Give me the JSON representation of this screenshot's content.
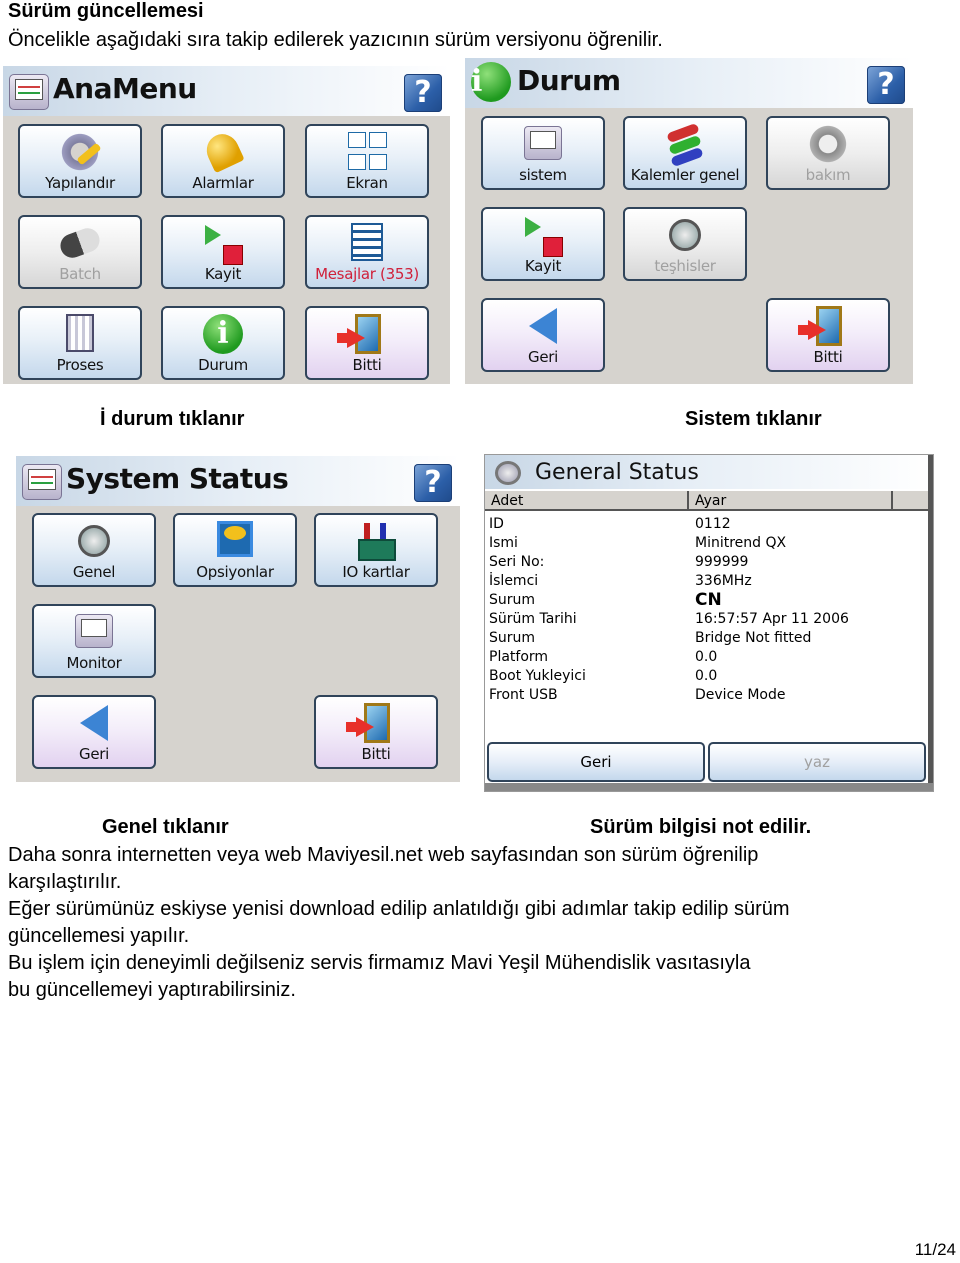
{
  "document": {
    "heading": "Sürüm güncellemesi",
    "intro": "Öncelikle aşağıdaki sıra takip edilerek yazıcının sürüm versiyonu öğrenilir.",
    "caption_1": "İ durum tıklanır",
    "caption_2": "Sistem tıklanır",
    "caption_3": "Genel tıklanır",
    "caption_4": "Sürüm bilgisi not edilir.",
    "paragraphs": [
      "Daha sonra internetten veya web Maviyesil.net web sayfasından son sürüm öğrenilip",
      "karşılaştırılır.",
      "Eğer sürümünüz eskiyse yenisi download edilip anlatıldığı gibi adımlar takip edilip sürüm",
      "güncellemesi yapılır.",
      "Bu işlem için deneyimli değilseniz servis firmamız Mavi Yeşil Mühendislik vasıtasıyla",
      "bu güncellemeyi yaptırabilirsiniz."
    ],
    "page_number": "11/24"
  },
  "ana_menu": {
    "title": "AnaMenu",
    "help": "?",
    "buttons": [
      {
        "label": "Yapılandır",
        "icon": "config-gear-icon",
        "state": "normal"
      },
      {
        "label": "Alarmlar",
        "icon": "bell-icon",
        "state": "normal"
      },
      {
        "label": "Ekran",
        "icon": "chart-grid-icon",
        "state": "normal"
      },
      {
        "label": "Batch",
        "icon": "pill-icon",
        "state": "disabled"
      },
      {
        "label": "Kayit",
        "icon": "play-stop-icon",
        "state": "normal"
      },
      {
        "label": "Mesajlar (353)",
        "icon": "message-list-icon",
        "state": "alert"
      },
      {
        "label": "Proses",
        "icon": "calculator-icon",
        "state": "normal"
      },
      {
        "label": "Durum",
        "icon": "info-icon",
        "state": "normal"
      },
      {
        "label": "Bitti",
        "icon": "exit-door-icon",
        "state": "exit"
      }
    ]
  },
  "durum": {
    "title": "Durum",
    "help": "?",
    "buttons": [
      {
        "label": "sistem",
        "icon": "monitor-icon",
        "state": "normal"
      },
      {
        "label": "Kalemler genel",
        "icon": "pens-icon",
        "state": "normal"
      },
      {
        "label": "bakım",
        "icon": "maintenance-gear-icon",
        "state": "disabled"
      },
      {
        "label": "Kayit",
        "icon": "play-stop-icon",
        "state": "normal"
      },
      {
        "label": "teşhisler",
        "icon": "diagnostics-icon",
        "state": "disabled"
      },
      {
        "label": "Geri",
        "icon": "back-arrow-icon",
        "state": "exit"
      },
      {
        "label": "Bitti",
        "icon": "exit-door-icon",
        "state": "exit"
      }
    ]
  },
  "system_status": {
    "title": "System Status",
    "help": "?",
    "buttons": [
      {
        "label": "Genel",
        "icon": "document-search-icon",
        "state": "normal"
      },
      {
        "label": "Opsiyonlar",
        "icon": "keys-certificate-icon",
        "state": "normal"
      },
      {
        "label": "IO kartlar",
        "icon": "io-card-icon",
        "state": "normal"
      },
      {
        "label": "Monitor",
        "icon": "monitor-search-icon",
        "state": "normal"
      },
      {
        "label": "Geri",
        "icon": "back-arrow-icon",
        "state": "exit"
      },
      {
        "label": "Bitti",
        "icon": "exit-door-icon",
        "state": "exit"
      }
    ]
  },
  "general_status": {
    "title": "General Status",
    "columns": [
      "Adet",
      "Ayar"
    ],
    "rows": [
      {
        "key": "ID",
        "value": "0112"
      },
      {
        "key": "Ismi",
        "value": "Minitrend QX"
      },
      {
        "key": "Seri No:",
        "value": "999999"
      },
      {
        "key": "İslemci",
        "value": "336MHz"
      },
      {
        "key": "Surum",
        "value": "CN"
      },
      {
        "key": "Sürüm Tarihi",
        "value": "16:57:57 Apr 11 2006"
      },
      {
        "key": "Surum",
        "value": "Bridge Not fitted"
      },
      {
        "key": "Platform",
        "value": "0.0"
      },
      {
        "key": "Boot Yukleyici",
        "value": "0.0"
      },
      {
        "key": "Front USB",
        "value": "Device Mode"
      }
    ],
    "back_label": "Geri",
    "write_label": "yaz"
  }
}
